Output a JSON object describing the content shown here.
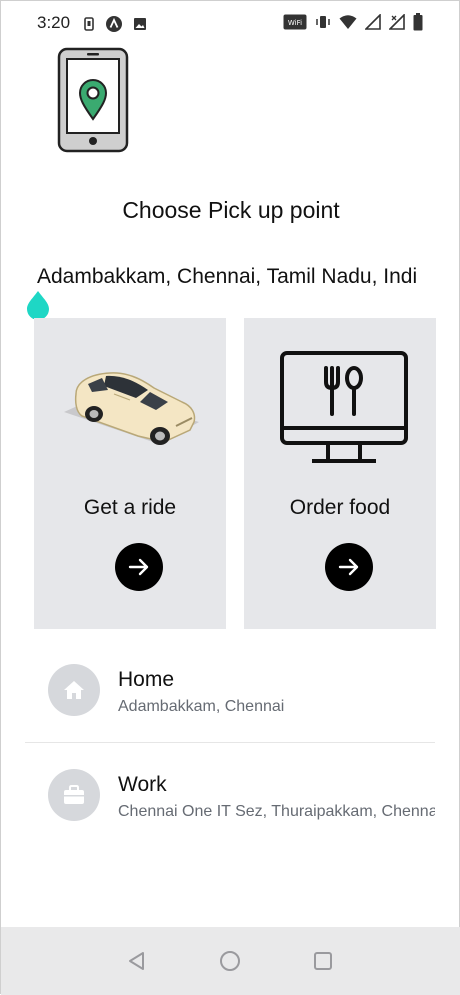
{
  "status_bar": {
    "time": "3:20",
    "left_icons": [
      "sim-card-icon",
      "app-a-icon",
      "image-icon"
    ],
    "right_icons": [
      "volte-wifi-icon",
      "vibrate-icon",
      "wifi-icon",
      "signal-icon",
      "signal-x-icon",
      "battery-icon"
    ],
    "volte_label": "VoWiFi"
  },
  "header": {
    "title": "Choose Pick up point"
  },
  "location": {
    "address": "Adambakkam, Chennai, Tamil Nadu, Indi"
  },
  "services": [
    {
      "label": "Get a ride",
      "icon": "car-icon"
    },
    {
      "label": "Order food",
      "icon": "monitor-fork-spoon-icon"
    }
  ],
  "saved_places": [
    {
      "name": "Home",
      "address": "Adambakkam, Chennai",
      "icon": "home-icon"
    },
    {
      "name": "Work",
      "address": "Chennai One IT Sez, Thuraipakkam, Chennai",
      "icon": "briefcase-icon"
    }
  ],
  "colors": {
    "accent": "#1ed7c5",
    "card_bg": "#e6e7ea",
    "avatar_bg": "#d6d8dc",
    "nav_bg": "#e9e9ea"
  }
}
